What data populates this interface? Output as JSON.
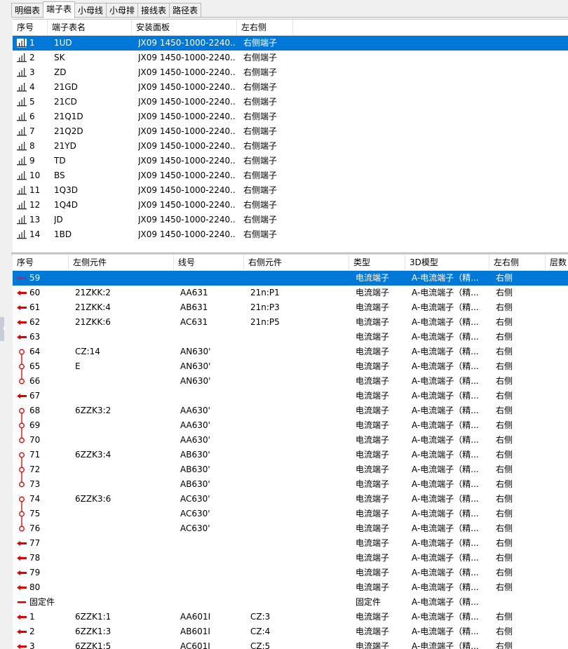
{
  "tabs": [
    "明细表",
    "端子表",
    "小母线",
    "小母排",
    "接线表",
    "路径表"
  ],
  "active_tab": "端子表",
  "colors": {
    "selection": "#0078d7",
    "red_icon": "#e00000",
    "purple_icon": "#7a3b8c"
  },
  "upper_table": {
    "headers": [
      "序号",
      "端子表名",
      "安装面板",
      "左右侧"
    ],
    "rows": [
      {
        "no": "1",
        "name": "1UD",
        "panel": "JX09 1450-1000-2240...",
        "side": "右侧端子",
        "selected": true
      },
      {
        "no": "2",
        "name": "SK",
        "panel": "JX09 1450-1000-2240...",
        "side": "右侧端子"
      },
      {
        "no": "3",
        "name": "ZD",
        "panel": "JX09 1450-1000-2240...",
        "side": "右侧端子"
      },
      {
        "no": "4",
        "name": "21GD",
        "panel": "JX09 1450-1000-2240...",
        "side": "右侧端子"
      },
      {
        "no": "5",
        "name": "21CD",
        "panel": "JX09 1450-1000-2240...",
        "side": "右侧端子"
      },
      {
        "no": "6",
        "name": "21Q1D",
        "panel": "JX09 1450-1000-2240...",
        "side": "右侧端子"
      },
      {
        "no": "7",
        "name": "21Q2D",
        "panel": "JX09 1450-1000-2240...",
        "side": "右侧端子"
      },
      {
        "no": "8",
        "name": "21YD",
        "panel": "JX09 1450-1000-2240...",
        "side": "右侧端子"
      },
      {
        "no": "9",
        "name": "TD",
        "panel": "JX09 1450-1000-2240...",
        "side": "右侧端子"
      },
      {
        "no": "10",
        "name": "BS",
        "panel": "JX09 1450-1000-2240...",
        "side": "右侧端子"
      },
      {
        "no": "11",
        "name": "1Q3D",
        "panel": "JX09 1450-1000-2240...",
        "side": "右侧端子"
      },
      {
        "no": "12",
        "name": "1Q4D",
        "panel": "JX09 1450-1000-2240...",
        "side": "右侧端子"
      },
      {
        "no": "13",
        "name": "JD",
        "panel": "JX09 1450-1000-2240...",
        "side": "右侧端子"
      },
      {
        "no": "14",
        "name": "1BD",
        "panel": "JX09 1450-1000-2240...",
        "side": "右侧端子"
      }
    ]
  },
  "lower_table": {
    "headers": [
      "序号",
      "左侧元件",
      "线号",
      "右侧元件",
      "类型",
      "3D模型",
      "左右侧",
      "层数"
    ],
    "rows": [
      {
        "icon": "purple-arrow",
        "no": "59",
        "left": "",
        "wire": "",
        "right": "",
        "type": "电流端子",
        "model": "A-电流端子（精...",
        "side": "右侧",
        "selected": true
      },
      {
        "icon": "red-arrow",
        "no": "60",
        "left": "21ZKK:2",
        "wire": "AA631",
        "right": "21n:P1",
        "type": "电流端子",
        "model": "A-电流端子（精...",
        "side": "右侧"
      },
      {
        "icon": "red-arrow",
        "no": "61",
        "left": "21ZKK:4",
        "wire": "AB631",
        "right": "21n:P3",
        "type": "电流端子",
        "model": "A-电流端子（精...",
        "side": "右侧"
      },
      {
        "icon": "red-arrow",
        "no": "62",
        "left": "21ZKK:6",
        "wire": "AC631",
        "right": "21n:P5",
        "type": "电流端子",
        "model": "A-电流端子（精...",
        "side": "右侧"
      },
      {
        "icon": "red-arrow",
        "no": "63",
        "left": "",
        "wire": "",
        "right": "",
        "type": "电流端子",
        "model": "A-电流端子（精...",
        "side": "右侧"
      },
      {
        "icon": "link-top",
        "no": "64",
        "left": "CZ:14",
        "wire": "AN630'",
        "right": "",
        "type": "电流端子",
        "model": "A-电流端子（精...",
        "side": "右侧"
      },
      {
        "icon": "link-mid",
        "no": "65",
        "left": "E",
        "wire": "AN630'",
        "right": "",
        "type": "电流端子",
        "model": "A-电流端子（精...",
        "side": "右侧"
      },
      {
        "icon": "link-bottom",
        "no": "66",
        "left": "",
        "wire": "AN630'",
        "right": "",
        "type": "电流端子",
        "model": "A-电流端子（精...",
        "side": "右侧"
      },
      {
        "icon": "red-arrow",
        "no": "67",
        "left": "",
        "wire": "",
        "right": "",
        "type": "电流端子",
        "model": "A-电流端子（精...",
        "side": "右侧"
      },
      {
        "icon": "link-top",
        "no": "68",
        "left": "6ZZK3:2",
        "wire": "AA630'",
        "right": "",
        "type": "电流端子",
        "model": "A-电流端子（精...",
        "side": "右侧"
      },
      {
        "icon": "link-mid",
        "no": "69",
        "left": "",
        "wire": "AA630'",
        "right": "",
        "type": "电流端子",
        "model": "A-电流端子（精...",
        "side": "右侧"
      },
      {
        "icon": "link-bottom",
        "no": "70",
        "left": "",
        "wire": "AA630'",
        "right": "",
        "type": "电流端子",
        "model": "A-电流端子（精...",
        "side": "右侧"
      },
      {
        "icon": "link-top",
        "no": "71",
        "left": "6ZZK3:4",
        "wire": "AB630'",
        "right": "",
        "type": "电流端子",
        "model": "A-电流端子（精...",
        "side": "右侧"
      },
      {
        "icon": "link-mid",
        "no": "72",
        "left": "",
        "wire": "AB630'",
        "right": "",
        "type": "电流端子",
        "model": "A-电流端子（精...",
        "side": "右侧"
      },
      {
        "icon": "link-bottom",
        "no": "73",
        "left": "",
        "wire": "AB630'",
        "right": "",
        "type": "电流端子",
        "model": "A-电流端子（精...",
        "side": "右侧"
      },
      {
        "icon": "link-top",
        "no": "74",
        "left": "6ZZK3:6",
        "wire": "AC630'",
        "right": "",
        "type": "电流端子",
        "model": "A-电流端子（精...",
        "side": "右侧"
      },
      {
        "icon": "link-mid",
        "no": "75",
        "left": "",
        "wire": "AC630'",
        "right": "",
        "type": "电流端子",
        "model": "A-电流端子（精...",
        "side": "右侧"
      },
      {
        "icon": "link-bottom",
        "no": "76",
        "left": "",
        "wire": "AC630'",
        "right": "",
        "type": "电流端子",
        "model": "A-电流端子（精...",
        "side": "右侧"
      },
      {
        "icon": "red-arrow",
        "no": "77",
        "left": "",
        "wire": "",
        "right": "",
        "type": "电流端子",
        "model": "A-电流端子（精...",
        "side": "右侧"
      },
      {
        "icon": "red-arrow",
        "no": "78",
        "left": "",
        "wire": "",
        "right": "",
        "type": "电流端子",
        "model": "A-电流端子（精...",
        "side": "右侧"
      },
      {
        "icon": "red-arrow",
        "no": "79",
        "left": "",
        "wire": "",
        "right": "",
        "type": "电流端子",
        "model": "A-电流端子（精...",
        "side": "右侧"
      },
      {
        "icon": "red-arrow",
        "no": "80",
        "left": "",
        "wire": "",
        "right": "",
        "type": "电流端子",
        "model": "A-电流端子（精...",
        "side": "右侧"
      },
      {
        "icon": "red-dash",
        "no": "固定件",
        "left": "",
        "wire": "",
        "right": "",
        "type": "固定件",
        "model": "A-电流端子（精...",
        "side": ""
      },
      {
        "icon": "red-arrow",
        "no": "1",
        "left": "6ZZK1:1",
        "wire": "AA601I",
        "right": "CZ:3",
        "type": "电流端子",
        "model": "A-电流端子（精...",
        "side": "右侧"
      },
      {
        "icon": "red-arrow",
        "no": "2",
        "left": "6ZZK1:3",
        "wire": "AB601I",
        "right": "CZ:4",
        "type": "电流端子",
        "model": "A-电流端子（精...",
        "side": "右侧"
      },
      {
        "icon": "red-arrow",
        "no": "3",
        "left": "6ZZK1:5",
        "wire": "AC601I",
        "right": "CZ:5",
        "type": "电流端子",
        "model": "A-电流端子（精...",
        "side": "右侧"
      }
    ]
  }
}
